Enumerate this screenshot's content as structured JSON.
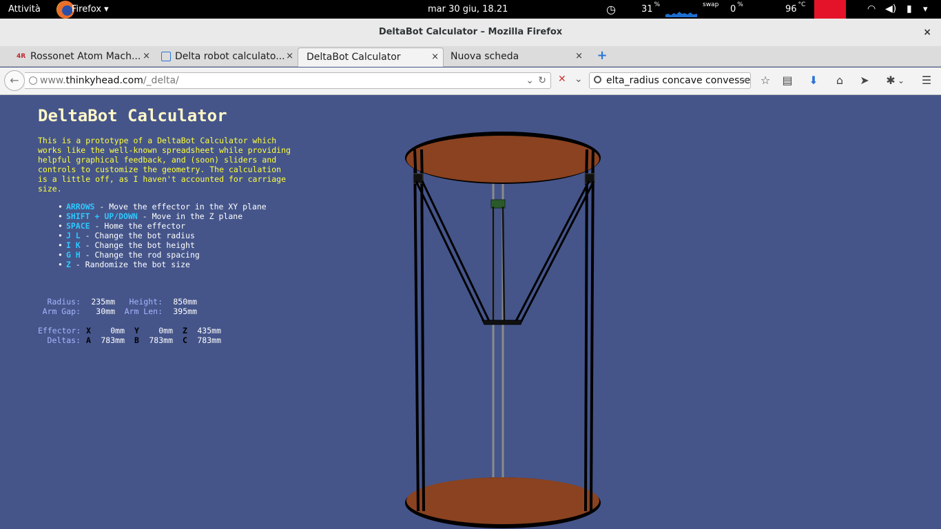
{
  "topbar": {
    "activities": "Attività",
    "app": "Firefox",
    "app_arrow": "▾",
    "clock": "mar 30 giu, 18.21",
    "cpu_value": "31",
    "cpu_unit": "%",
    "swap_label": "swap",
    "swap_value": "0",
    "swap_unit": "%",
    "temp_value": "96",
    "temp_unit": "°C",
    "menu_arrow": "▾"
  },
  "window": {
    "title": "DeltaBot Calculator – Mozilla Firefox",
    "close": "×"
  },
  "tabs": [
    {
      "label": "Rossonet Atom Mach...",
      "close": "×"
    },
    {
      "label": "Delta robot calculato...",
      "close": "×"
    },
    {
      "label": "DeltaBot Calculator",
      "close": "×"
    },
    {
      "label": "Nuova scheda",
      "close": "×"
    }
  ],
  "new_tab": "+",
  "navbar": {
    "url_prefix": "www.",
    "url_domain": "thinkyhead.com",
    "url_path": "/_delta/",
    "search_value": "elta_radius concave convesse",
    "search_go": "→"
  },
  "page": {
    "title": "DeltaBot Calculator",
    "intro": "This is a prototype of a DeltaBot Calculator which\nworks like the well-known spreadsheet while providing\nhelpful graphical feedback, and (soon) sliders and\ncontrols to customize the geometry. The calculation\nis a little off, as I haven't accounted for carriage\nsize.",
    "help": [
      {
        "key": "ARROWS",
        "text": " - Move the effector in the XY plane"
      },
      {
        "key": "SHIFT + UP/DOWN",
        "text": " - Move in the Z plane"
      },
      {
        "key": "SPACE",
        "text": " - Home the effector"
      },
      {
        "key": "J L",
        "text": " - Change the bot radius"
      },
      {
        "key": "I K",
        "text": " - Change the bot height"
      },
      {
        "key": "G H",
        "text": " - Change the rod spacing"
      },
      {
        "key": "Z",
        "text": " - Randomize the bot size"
      }
    ],
    "stats": {
      "radius_label": "Radius:",
      "radius": "235mm",
      "height_label": "Height:",
      "height": "850mm",
      "armgap_label": "Arm Gap:",
      "armgap": "30mm",
      "armlen_label": "Arm Len:",
      "armlen": "395mm",
      "effector_label": "Effector:",
      "x_label": "X",
      "x": "0mm",
      "y_label": "Y",
      "y": "0mm",
      "z_label": "Z",
      "z": "435mm",
      "deltas_label": "Deltas:",
      "a_label": "A",
      "a": "783mm",
      "b_label": "B",
      "b": "783mm",
      "c_label": "C",
      "c": "783mm"
    }
  },
  "colors": {
    "page_bg": "#45558a",
    "title": "#fff8c8",
    "intro": "#ffff3c",
    "key": "#2ec8ff",
    "disc": "#8a4220",
    "carriage": "#2a5a2a"
  },
  "icons": [
    "back-arrow-icon",
    "globe-icon",
    "reload-icon",
    "search-icon",
    "star-icon",
    "reading-list-icon",
    "download-icon",
    "home-icon",
    "send-icon",
    "addon-icon",
    "menu-icon"
  ]
}
